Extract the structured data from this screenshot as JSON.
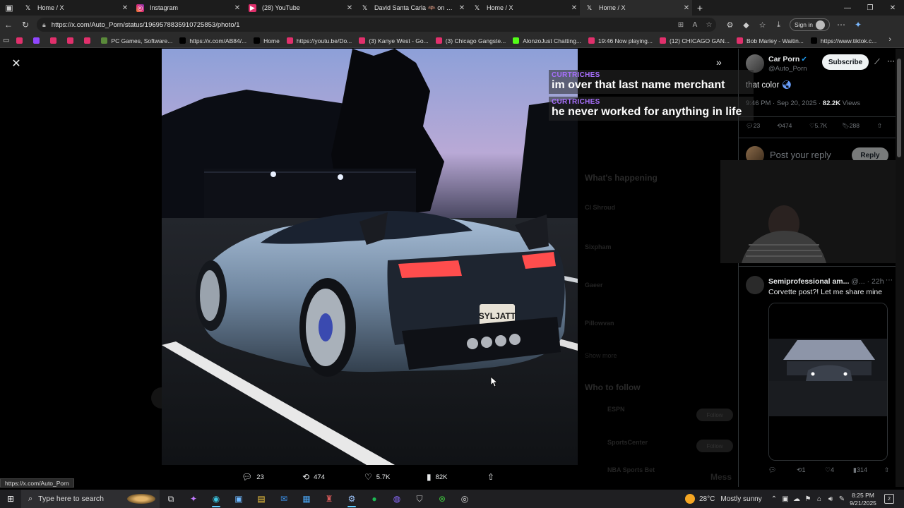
{
  "browser": {
    "tabs": [
      {
        "title": "Home / X",
        "icon": "x-logo-icon",
        "active": false
      },
      {
        "title": "Instagram",
        "icon": "instagram-icon",
        "active": false
      },
      {
        "title": "(28) YouTube",
        "icon": "youtube-icon",
        "active": false
      },
      {
        "title": "David Santa Carla 🦇 on X: \"In th",
        "icon": "x-logo-icon",
        "active": false
      },
      {
        "title": "Home / X",
        "icon": "x-logo-icon",
        "active": false
      },
      {
        "title": "Home / X",
        "icon": "x-logo-icon",
        "active": true
      }
    ],
    "url": "https://x.com/Auto_Porn/status/1969578835910725853/photo/1",
    "signin_label": "Sign in",
    "bookmarks": [
      {
        "label": "",
        "color": "#e1306c"
      },
      {
        "label": "",
        "color": "#9146ff"
      },
      {
        "label": "",
        "color": "#e1306c"
      },
      {
        "label": "",
        "color": "#e1306c"
      },
      {
        "label": "",
        "color": "#e1306c"
      },
      {
        "label": "PC Games, Software...",
        "color": "#5a8a3a"
      },
      {
        "label": "https://x.com/AB84/...",
        "color": "#000000"
      },
      {
        "label": "Home",
        "color": "#000000"
      },
      {
        "label": "https://youtu.be/Do...",
        "color": "#e1306c"
      },
      {
        "label": "(3) Kanye West - Go...",
        "color": "#e1306c"
      },
      {
        "label": "(3) Chicago Gangste...",
        "color": "#e1306c"
      },
      {
        "label": "AlonzoJust Chatting...",
        "color": "#53fc18"
      },
      {
        "label": "19:46 Now playing...",
        "color": "#e1306c"
      },
      {
        "label": "(12) CHICAGO GAN...",
        "color": "#e1306c"
      },
      {
        "label": "Bob Marley - Waitin...",
        "color": "#e1306c"
      },
      {
        "label": "https://www.tiktok.c...",
        "color": "#000000"
      }
    ]
  },
  "viewer": {
    "actions": {
      "replies": "23",
      "reposts": "474",
      "likes": "5.7K",
      "views": "82K"
    }
  },
  "tweet": {
    "author_name": "Car Porn",
    "author_handle": "@Auto_Porn",
    "subscribe_label": "Subscribe",
    "text": "that color",
    "time": "9:46 PM · Sep 20, 2025 · ",
    "views_count": "82.2K",
    "views_label": " Views",
    "stats": {
      "replies": "23",
      "reposts": "474",
      "likes": "5.7K",
      "bookmarks": "288"
    },
    "reply_placeholder": "Post your reply",
    "reply_button": "Reply"
  },
  "comment": {
    "name": "Semiprofessional am...",
    "handle": "@...",
    "time": "· 22h",
    "text": "Corvette post?! Let me share mine",
    "stats": {
      "replies": "",
      "reposts": "1",
      "likes": "4",
      "views": "314"
    }
  },
  "background": {
    "section_happening": "What's happening",
    "trends": [
      "Cl Shroud",
      "Sixpham",
      "Gaeer",
      "Pillowvan"
    ],
    "show_more": "Show more",
    "section_follow": "Who to follow",
    "follow_accounts": [
      "ESPN",
      "SportsCenter",
      "NBA Sports Bet"
    ],
    "follow_label": "Follow",
    "messages_label": "Mess"
  },
  "chat": {
    "messages": [
      {
        "user": "CURTRICHES",
        "text": "im over that last name merchant"
      },
      {
        "user": "CURTRICHES",
        "text": "he never worked for anything in life"
      }
    ],
    "user_color": "#a970ff"
  },
  "status_url": "https://x.com/Auto_Porn",
  "taskbar": {
    "search_placeholder": "Type here to search",
    "weather_temp": "28°C",
    "weather_desc": "Mostly sunny",
    "time": "8:25 PM",
    "date": "9/21/2025",
    "notifications": "2"
  },
  "colors": {
    "accent_blue": "#1d9bf0",
    "bg": "#000000",
    "text": "#e7e9ea",
    "muted": "#71767b"
  }
}
